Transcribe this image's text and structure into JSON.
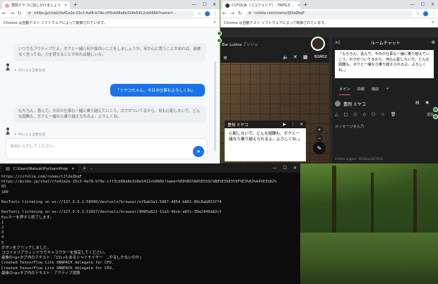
{
  "chat_window": {
    "tab_title": "豊岡ミヤコに話しかけましょう",
    "url": "miibo.jp/chat/cfa41a2e-15c3-4af8-b79e-cff3cb08a8e318e5412cb066b?name=…",
    "infobar": "Chrome は自動テスト ソフトウェアによって制御されています。",
    "messages": [
      {
        "role": "bot",
        "text": "いつでもアクティブだよ。ボクと一緒に何か面白いことをしましょうか。何か心に思うことがあれば、遠慮なく言ってね。力を貸せることがあれば嬉しいな。",
        "note": "AIによる自動生成"
      },
      {
        "role": "user",
        "text": "「ミヤコちゃん、今日の仕事もよろしくね」"
      },
      {
        "role": "bot",
        "text": "もちろん、喜んで。今日の仕事も一緒に乗り越えていこう。ボクがついてるから、何も心配しないで。どんな困難も、ボクと一緒なら乗り越えられるよ。よろしくね。",
        "note": "AIによる自動生成"
      }
    ],
    "input_placeholder": "自由に入力してください。",
    "icons": {
      "send": "send-icon",
      "sparkle": "sparkle-icon"
    }
  },
  "ccfolia_window": {
    "tab_title": "CCFOLIA（ココフォリア）- TRPGオ…",
    "url": "ccfolia.com/rooms/tJl2eZbqF",
    "infobar": "Chrome は自動テスト ソフトウェアによって制御されています。",
    "room_title": "Bar Lutina",
    "room_title_suffix": "アンジェ",
    "bgm": "BGM02",
    "panel_title": "ルームチャット",
    "log_text": "「もちろん、喜んで。今日の仕事も一緒に乗り越えていこう。ボクがついてるから、何も心配しないで。どんな困難も、ボクと一緒なら乗り越えられるよ。よろしくね。」",
    "tabs": [
      "メイン",
      "情報",
      "雑談",
      "+"
    ],
    "character_name": "豊岡 ミヤコ",
    "message_placeholder": "メッセージを入力",
    "send_label": "送信",
    "footer": "Ccfolia engine - 9CDGan5G7A16",
    "overlay_name": "豊岡 ミヤコ",
    "overlay_text": "心配しないで。どんな困難も、ボクと一緒なら乗り越えられるよ。よろしくね。」"
  },
  "terminal_window": {
    "tab_title": "C:\\Users\\Natsuki\\PycharmProje",
    "lines": [
      "https://ccfolia.com/rooms/tJl2eZbqF",
      "https://miibo.jp/chat/cfa41a2e-15c3-4af8-b79e-cff3cb08a8e318e5412cb066b?name=%E8%B1%8A%E5%9C%B8%E3%83%9F%E3%83%A4%E3%82%",
      "83",
      "100",
      "",
      "DevTools listening on ws://127.0.0.1:50996/devtools/browser/ef8ab3a1-5467-4854-b861-89c8ab853f74",
      "",
      "DevTools listening on ws://127.0.0.1:51027/devtools/browser/9085e822-11a3-46cb-a8fc-30a2449a82cf",
      "Escキーを押すと終了します。",
      "1",
      "2",
      "3",
      "4",
      "5",
      "ボタンをクリックしました。",
      "ココフォリアウィンドウでキャラクターを設定してください。",
      "最後の<p>タグ内のテキスト：「15Lvもあるシャドモイヤー　…やるしかないのか」",
      "Created TensorFlow Lite XNNPACK delegate for CPU.",
      "Created TensorFlow Lite XNNPACK delegate for CPU.",
      "最後の<p>タグ内のテキスト：アクティブ状態"
    ]
  },
  "colors": {
    "accent_blue": "#1a73e8",
    "terminal_bg": "#0c0c0c",
    "ccfolia_dark": "#1f1f1f",
    "ccfolia_tab_accent": "#e85a9b"
  }
}
